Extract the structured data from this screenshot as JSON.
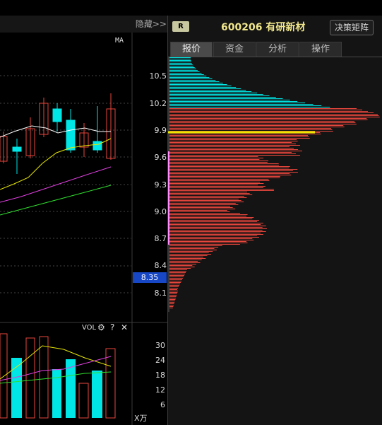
{
  "toolbar": {
    "hide_label": "隐藏>>"
  },
  "chart": {
    "ma_label": "MA"
  },
  "price_axis": {
    "ticks": [
      "10.5",
      "10.2",
      "9.9",
      "9.6",
      "9.3",
      "9.0",
      "8.7",
      "8.4",
      "8.1"
    ],
    "current": "8.35"
  },
  "volume": {
    "label": "VOL",
    "icons": [
      "gear-icon",
      "help-icon",
      "close-icon"
    ],
    "icon_glyphs": [
      "⚙",
      "?",
      "✕"
    ],
    "ticks": [
      "30",
      "24",
      "18",
      "12",
      "6"
    ],
    "unit": "X万"
  },
  "header": {
    "badge": "R",
    "stock_code": "600206",
    "stock_name": "有研新材",
    "matrix_button": "决策矩阵"
  },
  "tabs": [
    "报价",
    "资金",
    "分析",
    "操作"
  ],
  "active_tab": 0,
  "colors": {
    "up": "#e8463c",
    "down": "#00e5e5",
    "yellow": "#e8e800",
    "cost_line": "#ffffff",
    "accent": "#1747c4"
  }
}
